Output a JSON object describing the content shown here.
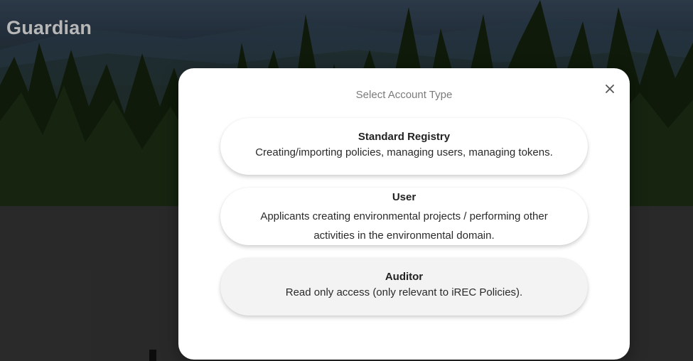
{
  "app": {
    "title": "Guardian"
  },
  "modal": {
    "title": "Select Account Type",
    "close_icon": "close-icon",
    "options": [
      {
        "title": "Standard Registry",
        "description": "Creating/importing policies, managing users, managing tokens.",
        "selected": false
      },
      {
        "title": "User",
        "description": "Applicants creating environmental projects / performing other activities in the environmental domain.",
        "selected": false
      },
      {
        "title": "Auditor",
        "description": "Read only access (only relevant to iREC Policies).",
        "selected": true
      }
    ]
  },
  "colors": {
    "modal_background": "#ffffff",
    "title_text": "#7b7b7b",
    "option_text": "#222222",
    "selected_option_background": "#f3f3f3",
    "app_title": "#b7b7b7"
  }
}
